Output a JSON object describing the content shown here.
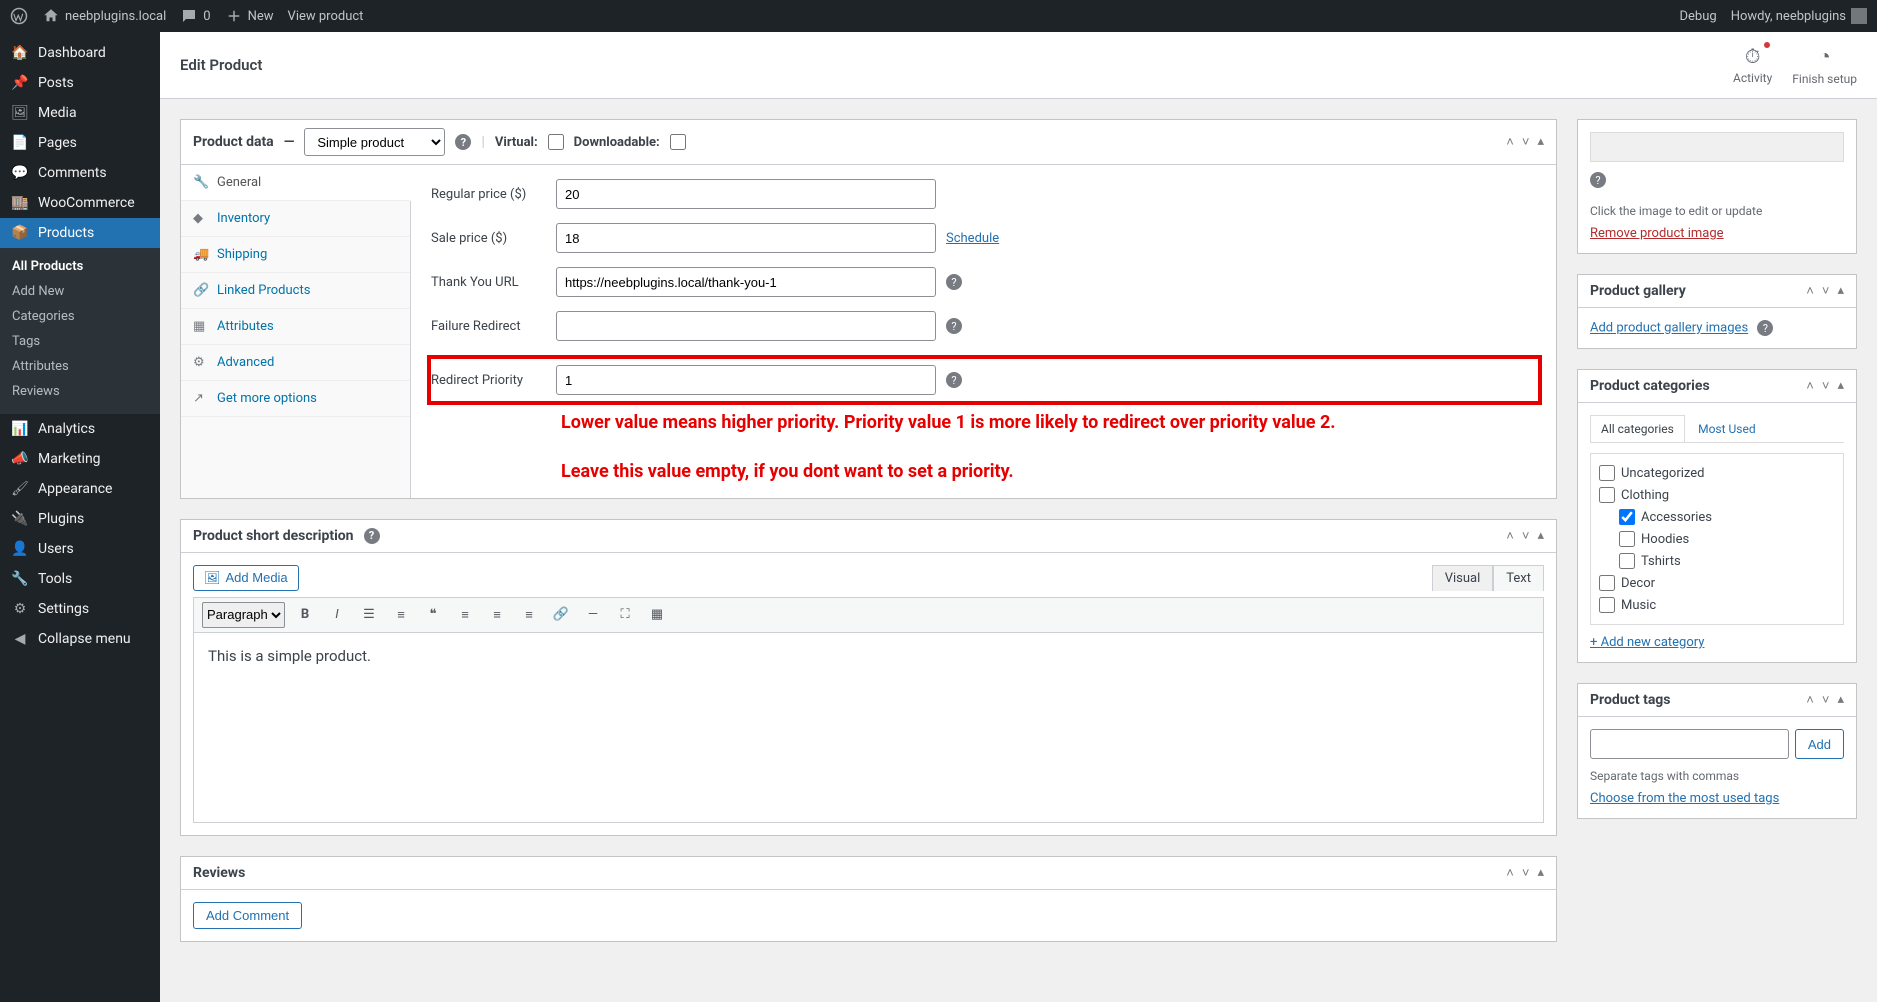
{
  "adminbar": {
    "site": "neebplugins.local",
    "comments": "0",
    "new_label": "New",
    "view_product": "View product",
    "debug": "Debug",
    "howdy": "Howdy, neebplugins"
  },
  "sidebar_menu": {
    "dashboard": "Dashboard",
    "posts": "Posts",
    "media": "Media",
    "pages": "Pages",
    "comments": "Comments",
    "woocommerce": "WooCommerce",
    "products": "Products",
    "analytics": "Analytics",
    "marketing": "Marketing",
    "appearance": "Appearance",
    "plugins": "Plugins",
    "users": "Users",
    "tools": "Tools",
    "settings": "Settings",
    "collapse": "Collapse menu"
  },
  "products_submenu": {
    "all": "All Products",
    "add": "Add New",
    "categories": "Categories",
    "tags": "Tags",
    "attributes": "Attributes",
    "reviews": "Reviews"
  },
  "header": {
    "title": "Edit Product",
    "activity": "Activity",
    "finish_setup": "Finish setup"
  },
  "product_data": {
    "title": "Product data",
    "dash": "—",
    "type_selected": "Simple product",
    "virtual_label": "Virtual:",
    "downloadable_label": "Downloadable:",
    "tabs": {
      "general": "General",
      "inventory": "Inventory",
      "shipping": "Shipping",
      "linked": "Linked Products",
      "attributes": "Attributes",
      "advanced": "Advanced",
      "more": "Get more options"
    },
    "fields": {
      "regular_price_label": "Regular price ($)",
      "regular_price_val": "20",
      "sale_price_label": "Sale price ($)",
      "sale_price_val": "18",
      "schedule": "Schedule",
      "thank_you_label": "Thank You URL",
      "thank_you_val": "https://neebplugins.local/thank-you-1",
      "failure_label": "Failure Redirect",
      "failure_val": "",
      "priority_label": "Redirect Priority",
      "priority_val": "1"
    },
    "annotation_line1": "Lower value means higher priority. Priority value 1 is more likely to redirect over priority value 2.",
    "annotation_line2": "Leave this value empty, if you dont want to set a priority."
  },
  "short_desc": {
    "title": "Product short description",
    "add_media": "Add Media",
    "visual": "Visual",
    "text_tab": "Text",
    "paragraph": "Paragraph",
    "content": "This is a simple product."
  },
  "reviews_box": {
    "title": "Reviews",
    "add_comment": "Add Comment"
  },
  "side": {
    "image_hint": "Click the image to edit or update",
    "remove_image": "Remove product image",
    "gallery_title": "Product gallery",
    "gallery_add": "Add product gallery images",
    "cats_title": "Product categories",
    "cat_tab_all": "All categories",
    "cat_tab_most": "Most Used",
    "cat_add_new": "+ Add new category",
    "tags_title": "Product tags",
    "tags_add": "Add",
    "tags_hint": "Separate tags with commas",
    "tags_choose": "Choose from the most used tags"
  },
  "categories": [
    {
      "label": "Uncategorized",
      "checked": false,
      "child": false
    },
    {
      "label": "Clothing",
      "checked": false,
      "child": false
    },
    {
      "label": "Accessories",
      "checked": true,
      "child": true
    },
    {
      "label": "Hoodies",
      "checked": false,
      "child": true
    },
    {
      "label": "Tshirts",
      "checked": false,
      "child": true
    },
    {
      "label": "Decor",
      "checked": false,
      "child": false
    },
    {
      "label": "Music",
      "checked": false,
      "child": false
    }
  ]
}
